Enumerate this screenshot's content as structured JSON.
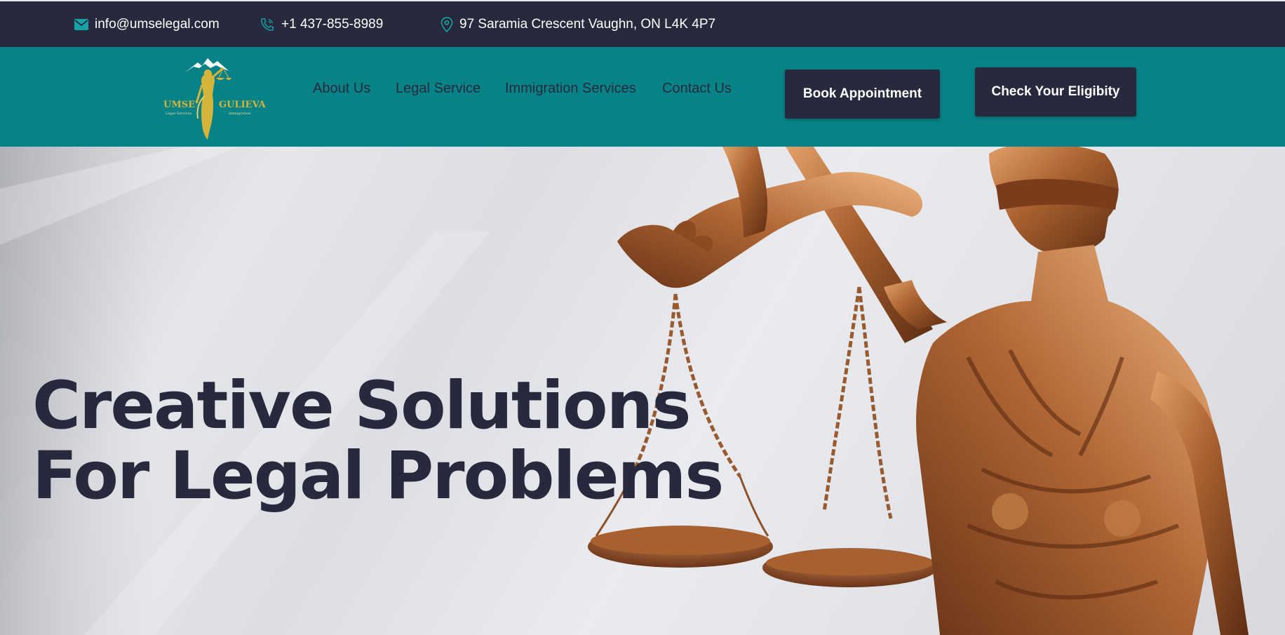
{
  "topbar": {
    "email": "info@umselegal.com",
    "phone": "+1 437-855-8989",
    "address": "97 Saramia Crescent Vaughn, ON L4K 4P7"
  },
  "logo": {
    "left_text": "UMSE",
    "right_text": "GULIEVA",
    "left_sub": "Legal Services",
    "right_sub": "Immigration"
  },
  "nav": {
    "items": [
      {
        "label": "About Us"
      },
      {
        "label": "Legal Service"
      },
      {
        "label": "Immigration Services"
      },
      {
        "label": "Contact Us"
      }
    ],
    "book_label": "Book Appointment",
    "eligibility_label": "Check Your Eligibity"
  },
  "hero": {
    "line1": "Creative Solutions",
    "line2": "For Legal Problems"
  },
  "colors": {
    "topbar_bg": "#262a3c",
    "nav_bg": "#078287",
    "accent_dark": "#262a3c",
    "logo_gold": "#d4b43a",
    "bronze": "#a8602e"
  },
  "icons": {
    "email": "envelope-icon",
    "phone": "phone-icon",
    "address": "map-pin-icon"
  }
}
